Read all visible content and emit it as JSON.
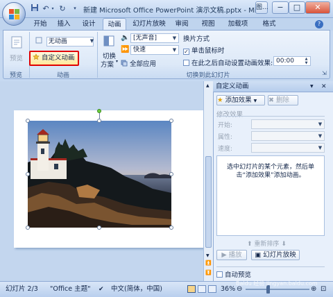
{
  "title_bar": {
    "title": "新建 Microsoft Office PowerPoint 演示文稿.pptx - Mi...",
    "quick_access": [
      "save-icon",
      "undo-icon",
      "redo-icon",
      "customize-icon"
    ],
    "window_extra": "图...",
    "minimize": "−",
    "maximize": "□",
    "close": "✕"
  },
  "tabs": [
    "开始",
    "插入",
    "设计",
    "动画",
    "幻灯片放映",
    "审阅",
    "视图",
    "加载项",
    "格式"
  ],
  "active_tab": "动画",
  "ribbon": {
    "preview": {
      "button": "预览",
      "group": "预览"
    },
    "animation": {
      "effect_value": "无动画",
      "custom_button": "自定义动画",
      "group": "动画"
    },
    "transition": {
      "switch_label_1": "切换",
      "switch_label_2": "方案",
      "sound_value": "[无声音]",
      "speed_value": "快速",
      "apply_all": "全部应用",
      "advance_heading": "换片方式",
      "on_click": "单击鼠标时",
      "on_click_checked": true,
      "auto_after": "在此之后自动设置动画效果:",
      "auto_after_checked": false,
      "auto_time": "00:00",
      "group": "切换到此幻灯片"
    }
  },
  "task_pane": {
    "title": "自定义动画",
    "add_effect": "添加效果",
    "remove": "删除",
    "modify_heading": "修改效果",
    "start_label": "开始:",
    "property_label": "属性:",
    "speed_label": "速度:",
    "hint_line1": "选中幻灯片的某个元素，然后单",
    "hint_line2": "击“添加效果”添加动画。",
    "reorder": "重新排序",
    "play": "播放",
    "slideshow": "幻灯片放映",
    "autopreview": "自动预览",
    "autopreview_checked": false
  },
  "status_bar": {
    "slide_info": "幻灯片 2/3",
    "theme": "\"Office 主题\"",
    "language": "中文(简体，中国)",
    "zoom": "36%",
    "watermark": "Baidu 经验 jingyan.baidu.com"
  },
  "colors": {
    "accent_red": "#e00000",
    "ribbon_bg": "#dde9f8",
    "workspace_bg": "#c3d6ee"
  }
}
